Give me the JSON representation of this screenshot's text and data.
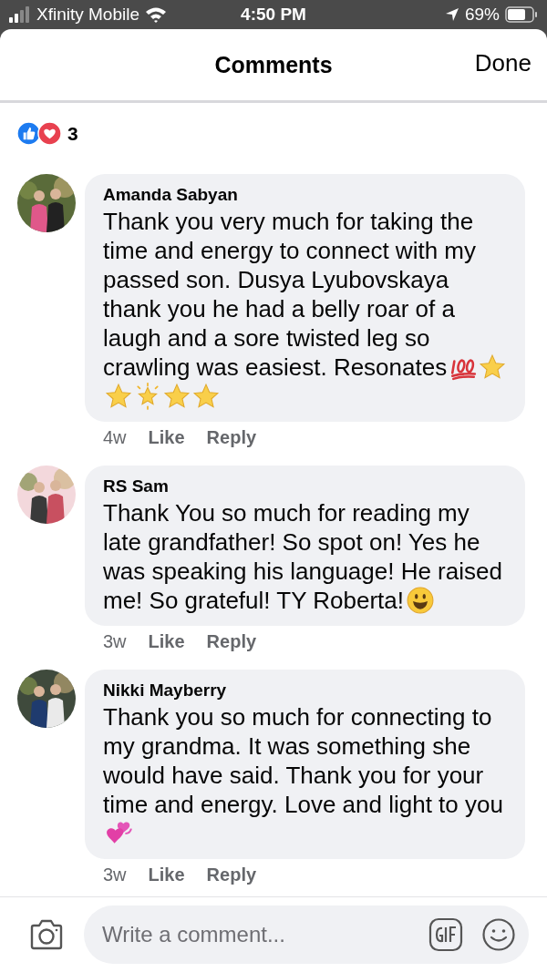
{
  "status_bar": {
    "carrier": "Xfinity Mobile",
    "time": "4:50 PM",
    "battery": "69%"
  },
  "header": {
    "title": "Comments",
    "done": "Done"
  },
  "reactions": {
    "count": "3"
  },
  "comments": [
    {
      "author": "Amanda Sabyan",
      "text": "Thank you very much for taking the time and energy to connect with my passed son. Dusya Lyubovskaya thank you he had a belly roar of a laugh and a sore twisted leg so crawling was easiest. Resonates",
      "emoji": [
        {
          "kind": "hundred"
        },
        {
          "kind": "star"
        },
        {
          "kind": "star"
        },
        {
          "kind": "sparkle"
        },
        {
          "kind": "star"
        },
        {
          "kind": "star"
        }
      ],
      "age": "4w",
      "like": "Like",
      "reply": "Reply"
    },
    {
      "author": "RS Sam",
      "text": "Thank You so much for reading my late grandfather! So spot on! Yes he was speaking his language! He raised me! So grateful! TY Roberta!",
      "emoji": [
        {
          "kind": "smile"
        }
      ],
      "age": "3w",
      "like": "Like",
      "reply": "Reply"
    },
    {
      "author": "Nikki Mayberry",
      "text": "Thank you so much for connecting to my grandma. It was something she would have said. Thank you for your time and energy. Love and light to you",
      "emoji": [
        {
          "kind": "hearts"
        }
      ],
      "age": "3w",
      "like": "Like",
      "reply": "Reply"
    }
  ],
  "composer": {
    "placeholder": "Write a comment..."
  }
}
